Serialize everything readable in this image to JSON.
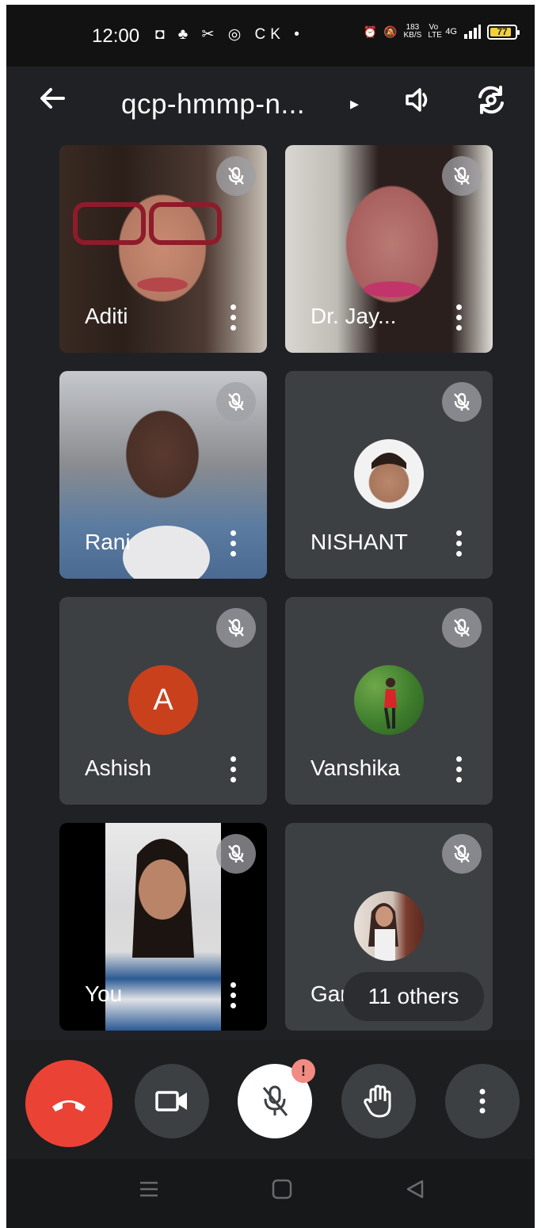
{
  "status_bar": {
    "time": "12:00",
    "left_icons": "◘ ♣ ✂ ◎ CK •",
    "net_speed_value": "183",
    "net_speed_unit": "KB/S",
    "volte": "Vo LTE",
    "network": "4G",
    "battery": "77"
  },
  "header": {
    "meeting_code": "qcp-hmmp-n...",
    "caret": "▸"
  },
  "participants": [
    {
      "name": "Aditi",
      "muted": true,
      "type": "video"
    },
    {
      "name": "Dr. Jay...",
      "muted": true,
      "type": "video"
    },
    {
      "name": "Rani",
      "muted": true,
      "type": "video"
    },
    {
      "name": "NISHANT",
      "muted": true,
      "type": "photo-avatar"
    },
    {
      "name": "Ashish",
      "muted": true,
      "type": "letter-avatar",
      "letter": "A"
    },
    {
      "name": "Vanshika",
      "muted": true,
      "type": "photo-avatar"
    },
    {
      "name": "You",
      "muted": true,
      "type": "video"
    },
    {
      "name": "Gargi",
      "muted": true,
      "type": "photo-avatar"
    }
  ],
  "others_pill": "11 others",
  "controls": {
    "mic_badge": "!"
  },
  "colors": {
    "background": "#202124",
    "tile": "#3c4043",
    "end_call": "#ea4335",
    "letter_avatar": "#c9401d"
  }
}
